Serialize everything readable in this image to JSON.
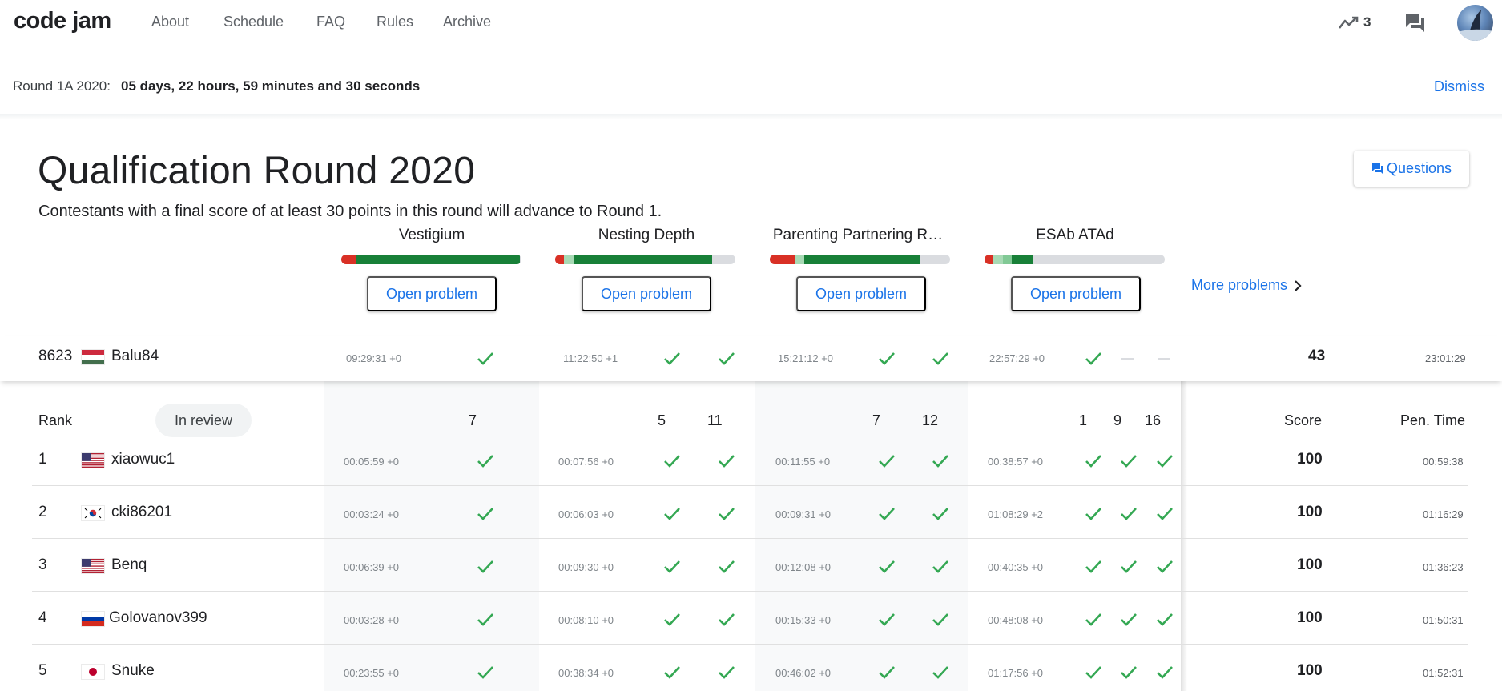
{
  "app": {
    "logo": "code jam",
    "nav": [
      "About",
      "Schedule",
      "FAQ",
      "Rules",
      "Archive"
    ],
    "trend_count": "3"
  },
  "banner": {
    "label": "Round 1A 2020:",
    "time": "05 days, 22 hours, 59 minutes and 30 seconds",
    "dismiss": "Dismiss"
  },
  "contest": {
    "title": "Qualification Round 2020",
    "subtitle": "Contestants with a final score of at least 30 points in this round will advance to Round 1.",
    "questions_label": "Questions"
  },
  "problems": [
    {
      "name": "Vestigium",
      "open_label": "Open problem",
      "bar": [
        {
          "color": "#d93025",
          "frac": 0.08
        },
        {
          "color": "#188038",
          "frac": 0.91
        }
      ]
    },
    {
      "name": "Nesting Depth",
      "open_label": "Open problem",
      "bar": [
        {
          "color": "#d93025",
          "frac": 0.05
        },
        {
          "color": "#a8dab5",
          "frac": 0.05
        },
        {
          "color": "#188038",
          "frac": 0.77
        }
      ]
    },
    {
      "name": "Parenting Partnering R…",
      "open_label": "Open problem",
      "bar": [
        {
          "color": "#d93025",
          "frac": 0.14
        },
        {
          "color": "#a8dab5",
          "frac": 0.05
        },
        {
          "color": "#188038",
          "frac": 0.64
        }
      ]
    },
    {
      "name": "ESAb ATAd",
      "open_label": "Open problem",
      "bar": [
        {
          "color": "#d93025",
          "frac": 0.05
        },
        {
          "color": "#a8dab5",
          "frac": 0.05
        },
        {
          "color": "#81c995",
          "frac": 0.05
        },
        {
          "color": "#188038",
          "frac": 0.12
        }
      ]
    }
  ],
  "more_problems": "More problems",
  "own_row": {
    "rank": "8623",
    "flag": "hungary",
    "name": "Balu84",
    "times": [
      "09:29:31 +0",
      "11:22:50 +1",
      "15:21:12 +0",
      "22:57:29 +0"
    ],
    "score": "43",
    "penalty": "23:01:29"
  },
  "table": {
    "rank_header": "Rank",
    "in_review": "In review",
    "points": [
      "7",
      "5",
      "11",
      "7",
      "12",
      "1",
      "9",
      "16"
    ],
    "score_header": "Score",
    "pen_header": "Pen. Time",
    "rows": [
      {
        "rank": "1",
        "flag": "usa",
        "name": "xiaowuc1",
        "times": [
          "00:05:59 +0",
          "00:07:56 +0",
          "00:11:55 +0",
          "00:38:57 +0"
        ],
        "score": "100",
        "penalty": "00:59:38"
      },
      {
        "rank": "2",
        "flag": "korea",
        "name": "cki86201",
        "times": [
          "00:03:24 +0",
          "00:06:03 +0",
          "00:09:31 +0",
          "01:08:29 +2"
        ],
        "score": "100",
        "penalty": "01:16:29"
      },
      {
        "rank": "3",
        "flag": "usa",
        "name": "Benq",
        "times": [
          "00:06:39 +0",
          "00:09:30 +0",
          "00:12:08 +0",
          "00:40:35 +0"
        ],
        "score": "100",
        "penalty": "01:36:23"
      },
      {
        "rank": "4",
        "flag": "russia",
        "name": "Golovanov399",
        "times": [
          "00:03:28 +0",
          "00:08:10 +0",
          "00:15:33 +0",
          "00:48:08 +0"
        ],
        "score": "100",
        "penalty": "01:50:31"
      },
      {
        "rank": "5",
        "flag": "japan",
        "name": "Snuke",
        "times": [
          "00:23:55 +0",
          "00:38:34 +0",
          "00:46:02 +0",
          "01:17:56 +0"
        ],
        "score": "100",
        "penalty": "01:52:31"
      }
    ]
  },
  "colors": {
    "accent": "#1a73e8",
    "check": "#34a853",
    "fail": "#d93025"
  }
}
